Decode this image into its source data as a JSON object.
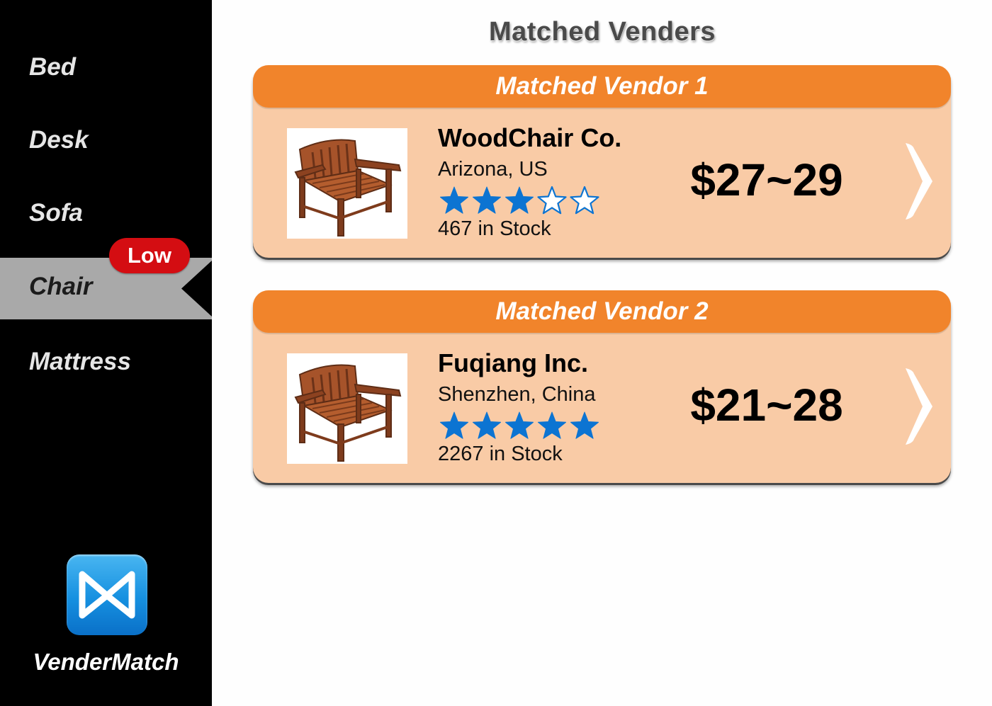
{
  "sidebar": {
    "items": [
      {
        "label": "Bed"
      },
      {
        "label": "Desk"
      },
      {
        "label": "Sofa"
      },
      {
        "label": "Chair",
        "active": true,
        "badge": "Low"
      },
      {
        "label": "Mattress"
      }
    ],
    "app_name": "VenderMatch",
    "logo_icon": "vendermatch-logo-icon"
  },
  "main": {
    "title": "Matched Venders",
    "vendors": [
      {
        "header": "Matched Vendor 1",
        "name": "WoodChair Co.",
        "location": "Arizona, US",
        "rating": 3,
        "max_rating": 5,
        "stock": "467 in Stock",
        "price": "$27~29",
        "image_icon": "wooden-chair-image"
      },
      {
        "header": "Matched Vendor 2",
        "name": "Fuqiang Inc.",
        "location": "Shenzhen, China",
        "rating": 5,
        "max_rating": 5,
        "stock": "2267 in Stock",
        "price": "$21~28",
        "image_icon": "wooden-chair-image"
      }
    ]
  },
  "colors": {
    "sidebar_bg": "#000000",
    "active_item_bg": "#a9a9a9",
    "badge": "#d40d12",
    "card_header": "#f1842b",
    "card_body": "#f9cba6",
    "star": "#0c74d2"
  }
}
